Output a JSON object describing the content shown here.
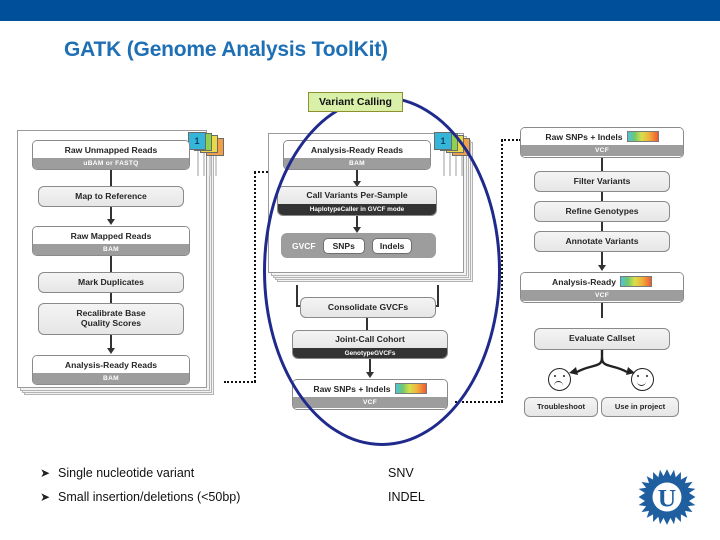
{
  "slide": {
    "title": "GATK (Genome Analysis ToolKit)",
    "accent_color": "#004F9B",
    "title_color": "#1F6FB4",
    "ellipse_color": "#1F2A8C"
  },
  "callout": {
    "label": "Variant Calling",
    "bg_color": "#d9f0a8",
    "border_color": "#8f8f2e"
  },
  "phase1": {
    "tab_number": "1",
    "tab_colors": [
      "#35b5d8",
      "#8fd14f",
      "#e8d84a",
      "#f0a04b"
    ],
    "boxes": {
      "raw_unmapped_title": "Raw Unmapped Reads",
      "raw_unmapped_sub": "uBAM or FASTQ",
      "map_to_reference": "Map to Reference",
      "raw_mapped_title": "Raw Mapped Reads",
      "raw_mapped_sub": "BAM",
      "mark_duplicates": "Mark Duplicates",
      "recalibrate_base": "Recalibrate Base",
      "recalibrate_quality": "Quality Scores",
      "analysis_ready_title": "Analysis-Ready Reads",
      "analysis_ready_sub": "BAM"
    }
  },
  "phase2": {
    "tab_number": "1",
    "boxes": {
      "analysis_ready_title": "Analysis-Ready Reads",
      "analysis_ready_sub": "BAM",
      "call_variants_title": "Call Variants Per-Sample",
      "call_variants_sub": "HaplotypeCaller in GVCF mode",
      "gvcf_label": "GVCF",
      "snps_label": "SNPs",
      "indels_label": "Indels",
      "consolidate": "Consolidate GVCFs",
      "joint_call_title": "Joint-Call Cohort",
      "joint_call_sub": "GenotypeGVCFs",
      "raw_snps_title": "Raw SNPs + Indels",
      "raw_snps_sub": "VCF"
    }
  },
  "phase3": {
    "boxes": {
      "raw_snps_title": "Raw SNPs + Indels",
      "raw_snps_sub": "VCF",
      "filter_variants": "Filter Variants",
      "refine_genotypes": "Refine Genotypes",
      "annotate_variants": "Annotate Variants",
      "analysis_ready_title": "Analysis-Ready",
      "analysis_ready_sub": "VCF",
      "evaluate_callset": "Evaluate Callset",
      "troubleshoot": "Troubleshoot",
      "use_in_project": "Use in project"
    }
  },
  "bullets": [
    {
      "marker": "➤",
      "text": "Single nucleotide variant",
      "code": "SNV"
    },
    {
      "marker": "➤",
      "text": "Small insertion/deletions (<50bp)",
      "code": "INDEL"
    }
  ],
  "logo": {
    "letter": "U",
    "color": "#1F5FA0"
  }
}
